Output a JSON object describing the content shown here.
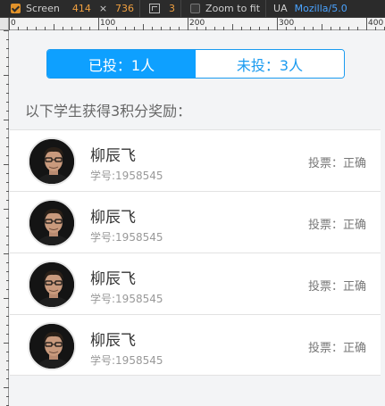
{
  "devtools": {
    "screen_label": "Screen",
    "width": "414",
    "times": "×",
    "height": "736",
    "dpr": "3",
    "zoom_label": "Zoom to fit",
    "ua_label": "UA",
    "ua_value": "Mozilla/5.0"
  },
  "ruler": {
    "labels": [
      "0",
      "100",
      "200",
      "300",
      "400"
    ]
  },
  "tabs": {
    "voted": "已投：1人",
    "not_voted": "未投：3人"
  },
  "subtitle": "以下学生获得3积分奖励：",
  "students": [
    {
      "name": "柳辰飞",
      "student_id": "学号:1958545",
      "vote": "投票：正确"
    },
    {
      "name": "柳辰飞",
      "student_id": "学号:1958545",
      "vote": "投票：正确"
    },
    {
      "name": "柳辰飞",
      "student_id": "学号:1958545",
      "vote": "投票：正确"
    },
    {
      "name": "柳辰飞",
      "student_id": "学号:1958545",
      "vote": "投票：正确"
    }
  ]
}
